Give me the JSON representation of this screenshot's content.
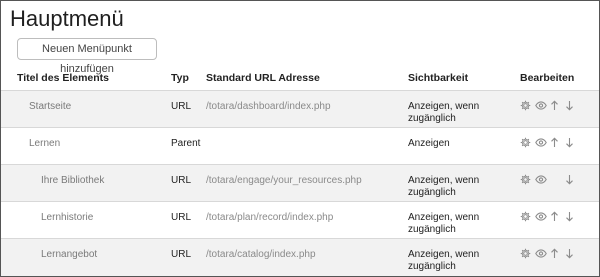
{
  "page": {
    "title": "Hauptmenü",
    "add_button_label": "Neuen Menüpunkt hinzufügen"
  },
  "table": {
    "headers": {
      "title": "Titel des Elements",
      "type": "Typ",
      "url": "Standard URL Adresse",
      "visibility": "Sichtbarkeit",
      "edit": "Bearbeiten"
    },
    "rows": [
      {
        "title": "Startseite",
        "type": "URL",
        "url": "/totara/dashboard/index.php",
        "visibility": "Anzeigen, wenn zugänglich",
        "level": 1,
        "actions": [
          "gear-icon",
          "eye-icon",
          "arrow-up-icon",
          "arrow-down-icon"
        ]
      },
      {
        "title": "Lernen",
        "type": "Parent",
        "url": "",
        "visibility": "Anzeigen",
        "level": 1,
        "actions": [
          "gear-icon",
          "eye-icon",
          "arrow-up-icon",
          "arrow-down-icon"
        ]
      },
      {
        "title": "Ihre Bibliothek",
        "type": "URL",
        "url": "/totara/engage/your_resources.php",
        "visibility": "Anzeigen, wenn zugänglich",
        "level": 2,
        "actions": [
          "gear-icon",
          "eye-icon",
          "arrow-down-icon"
        ]
      },
      {
        "title": "Lernhistorie",
        "type": "URL",
        "url": "/totara/plan/record/index.php",
        "visibility": "Anzeigen, wenn zugänglich",
        "level": 2,
        "actions": [
          "gear-icon",
          "eye-icon",
          "arrow-up-icon",
          "arrow-down-icon"
        ]
      },
      {
        "title": "Lernangebot",
        "type": "URL",
        "url": "/totara/catalog/index.php",
        "visibility": "Anzeigen, wenn zugänglich",
        "level": 2,
        "actions": [
          "gear-icon",
          "eye-icon",
          "arrow-up-icon",
          "arrow-down-icon"
        ]
      }
    ]
  },
  "colors": {
    "row_shaded": "#f2f2f2",
    "icon": "#8c8c8c",
    "muted_text": "#7a7a7a"
  }
}
